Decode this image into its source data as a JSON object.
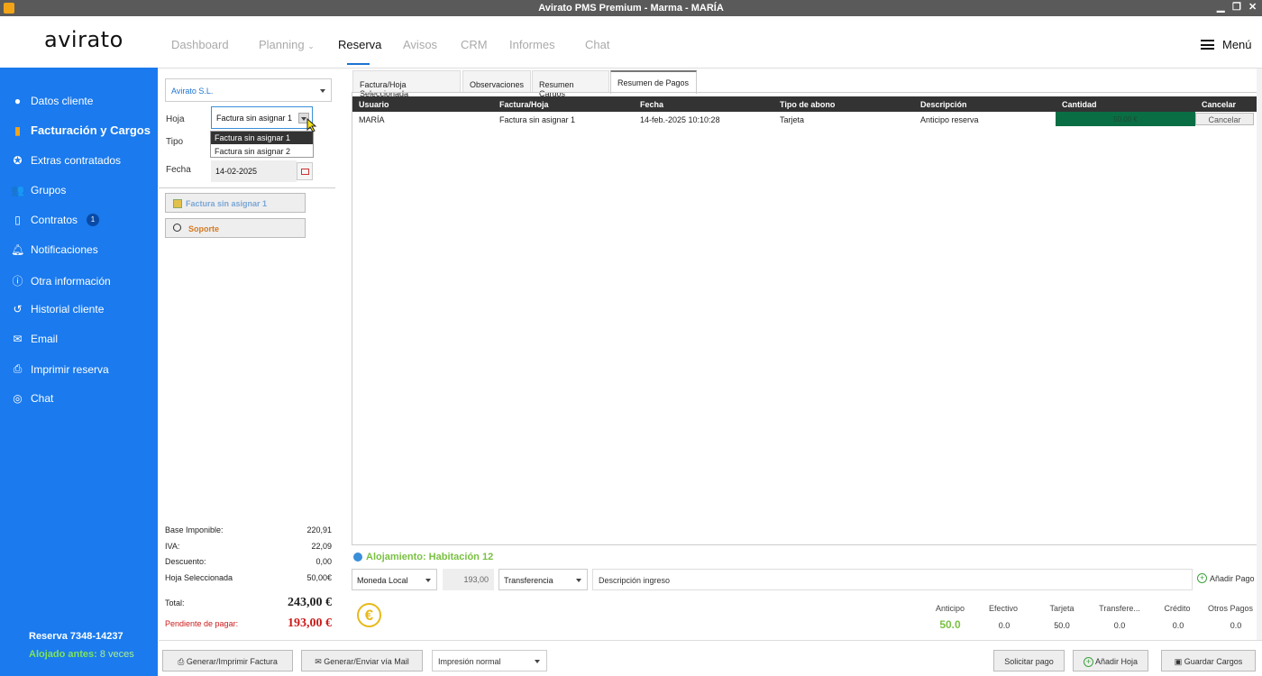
{
  "window": {
    "title": "Avirato PMS Premium - Marma - MARÍA"
  },
  "header": {
    "logo": "avirato",
    "nav": {
      "dashboard": "Dashboard",
      "planning": "Planning",
      "reserva": "Reserva",
      "avisos": "Avisos",
      "crm": "CRM",
      "informes": "Informes",
      "chat": "Chat"
    },
    "menu_label": "Menú"
  },
  "sidebar": {
    "items": [
      {
        "label": "Datos cliente",
        "icon": "user-circle-icon"
      },
      {
        "label": "Facturación y Cargos",
        "icon": "file-icon"
      },
      {
        "label": "Extras contratados",
        "icon": "star-icon"
      },
      {
        "label": "Grupos",
        "icon": "group-icon"
      },
      {
        "label": "Contratos",
        "icon": "document-icon",
        "badge": "1"
      },
      {
        "label": "Notificaciones",
        "icon": "bell-icon"
      },
      {
        "label": "Otra información",
        "icon": "info-icon"
      },
      {
        "label": "Historial cliente",
        "icon": "history-icon"
      },
      {
        "label": "Email",
        "icon": "mail-icon"
      },
      {
        "label": "Imprimir reserva",
        "icon": "printer-icon"
      },
      {
        "label": "Chat",
        "icon": "whatsapp-icon"
      }
    ],
    "reserva_id": "Reserva 7348-14237",
    "alojado_label": "Alojado antes:",
    "alojado_value": "8 veces"
  },
  "left_panel": {
    "company": "Avirato S.L.",
    "hoja_label": "Hoja",
    "hoja_value": "Factura  sin asignar 1",
    "hoja_options": [
      "Factura  sin asignar 1",
      "Factura  sin asignar 2"
    ],
    "tipo_label": "Tipo",
    "fecha_label": "Fecha",
    "fecha_value": "14-02-2025",
    "factura_btn": "Factura  sin asignar 1",
    "soporte_btn": "Soporte",
    "summary": {
      "base_label": "Base Imponible:",
      "base_value": "220,91",
      "iva_label": "IVA:",
      "iva_value": "22,09",
      "descuento_label": "Descuento:",
      "descuento_value": "0,00",
      "hoja_sel_label": "Hoja Seleccionada",
      "hoja_sel_value": "50,00€",
      "total_label": "Total:",
      "total_value": "243,00 €",
      "pendiente_label": "Pendiente de pagar:",
      "pendiente_value": "193,00 €"
    }
  },
  "tabs": [
    "Factura/Hoja Seleccionada",
    "Observaciones",
    "Resumen Cargos",
    "Resumen de Pagos"
  ],
  "table": {
    "headers": [
      "Usuario",
      "Factura/Hoja",
      "Fecha",
      "Tipo de abono",
      "Descripción",
      "Cantidad",
      "Cancelar"
    ],
    "rows": [
      {
        "usuario": "MARÍA",
        "factura": "Factura  sin asignar 1",
        "fecha": "14-feb.-2025 10:10:28",
        "tipo": "Tarjeta",
        "descripcion": "Anticipo reserva",
        "cantidad": "50,00 €",
        "cancelar": "Cancelar"
      }
    ]
  },
  "payment": {
    "alojamiento": "Alojamiento: Habitación 12",
    "moneda": "Moneda Local",
    "amount": "193,00",
    "metodo": "Transferencia",
    "descripcion": "Descripción ingreso",
    "add_pago": "Añadir Pago",
    "stats": {
      "anticipo_label": "Anticipo",
      "anticipo_value": "50.0",
      "efectivo_label": "Efectivo",
      "efectivo_value": "0.0",
      "tarjeta_label": "Tarjeta",
      "tarjeta_value": "50.0",
      "transfer_label": "Transfere...",
      "transfer_value": "0.0",
      "credito_label": "Crédito",
      "credito_value": "0.0",
      "otros_label": "Otros Pagos",
      "otros_value": "0.0"
    }
  },
  "footer": {
    "generar_imprimir": "Generar/Imprimir Factura",
    "generar_mail": "Generar/Enviar vía Mail",
    "impresion": "Impresión normal",
    "solicitar": "Solicitar pago",
    "anadir_hoja": "Añadir Hoja",
    "guardar": "Guardar Cargos"
  },
  "colors": {
    "sidebar": "#1a7aee",
    "accent_green": "#7ac142",
    "total_red": "#cc1b1b",
    "cantidad_cell": "#0a6e45"
  }
}
